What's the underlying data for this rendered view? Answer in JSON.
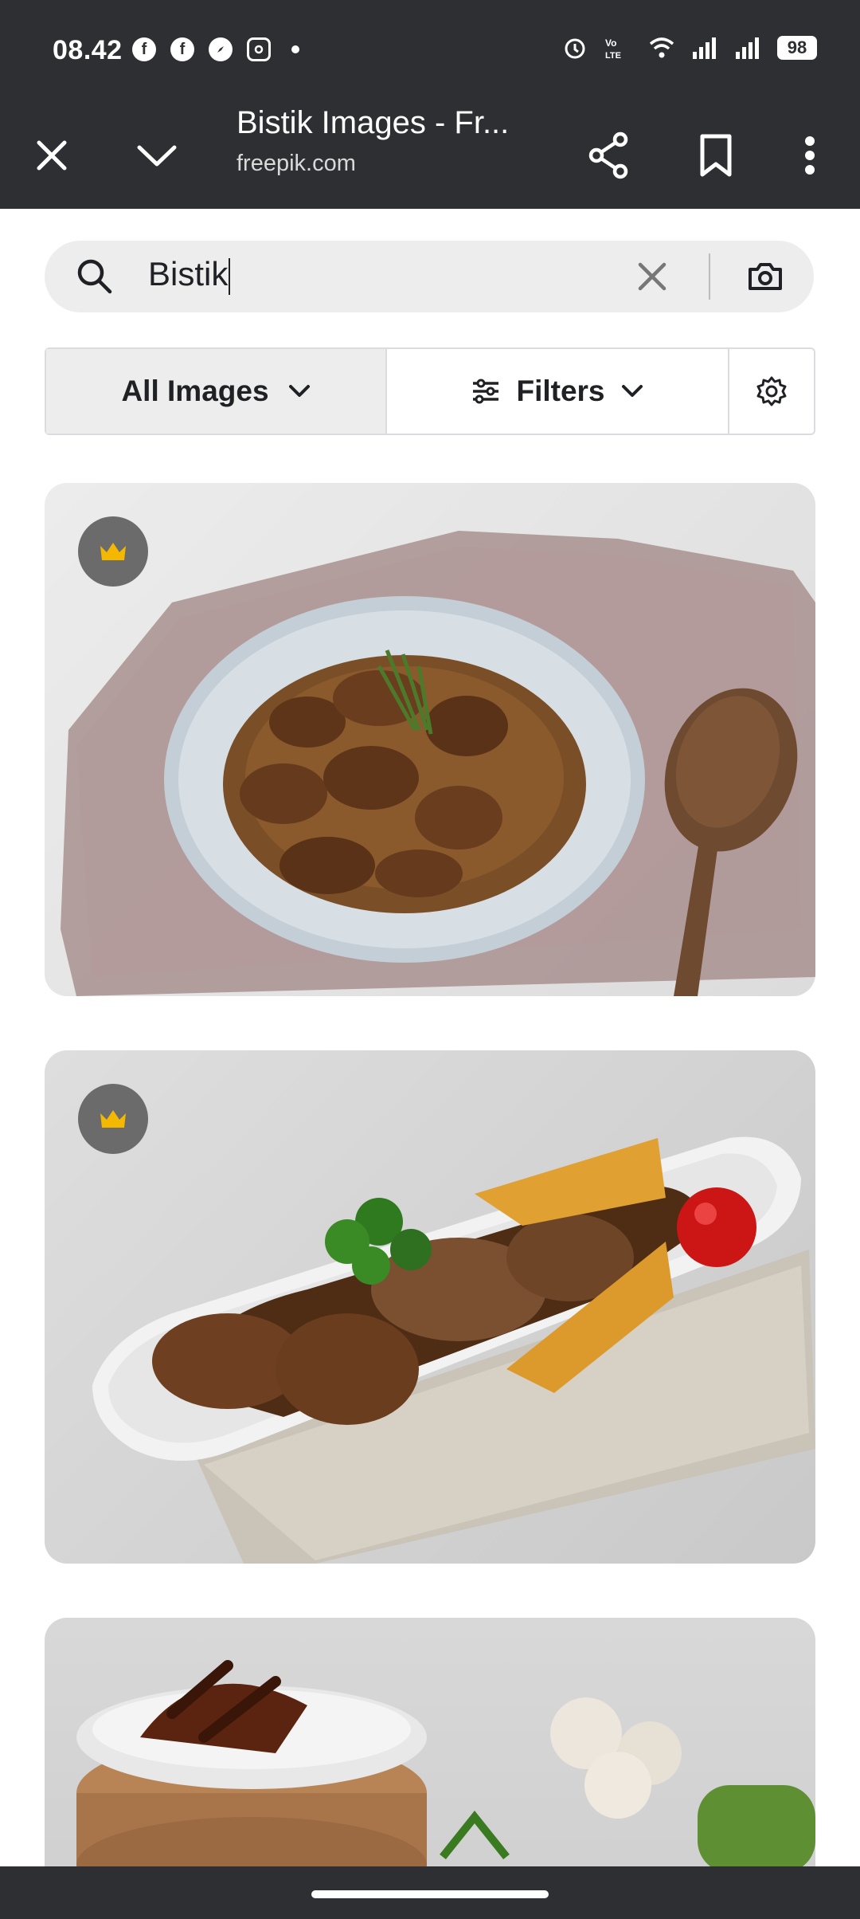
{
  "status_bar": {
    "time": "08.42",
    "battery": "98",
    "icons": [
      "facebook-icon",
      "facebook-icon",
      "compass-icon",
      "instagram-icon",
      "alarm-icon",
      "volte-icon",
      "wifi-icon",
      "signal-icon",
      "signal-icon"
    ]
  },
  "toolbar": {
    "title": "Bistik Images - Fr...",
    "domain": "freepik.com"
  },
  "search": {
    "value": "Bistik"
  },
  "filters": {
    "all_images": "All Images",
    "filters": "Filters"
  },
  "results": [
    {
      "premium": true,
      "subject": "beef stew in bowl"
    },
    {
      "premium": true,
      "subject": "beef with potatoes"
    },
    {
      "premium": false,
      "subject": "partial image"
    }
  ],
  "colors": {
    "toolbar": "#2e2f33",
    "premium_crown": "#f5b800",
    "search_bg": "#ededed"
  }
}
